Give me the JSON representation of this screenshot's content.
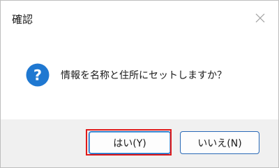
{
  "dialog": {
    "title": "確認",
    "message": "情報を名称と住所にセットしますか？",
    "icon": "question-icon",
    "accent_color": "#1f78d1",
    "highlight_color": "#e01919"
  },
  "buttons": {
    "yes_label": "はい(Y)",
    "no_label": "いいえ(N)"
  }
}
